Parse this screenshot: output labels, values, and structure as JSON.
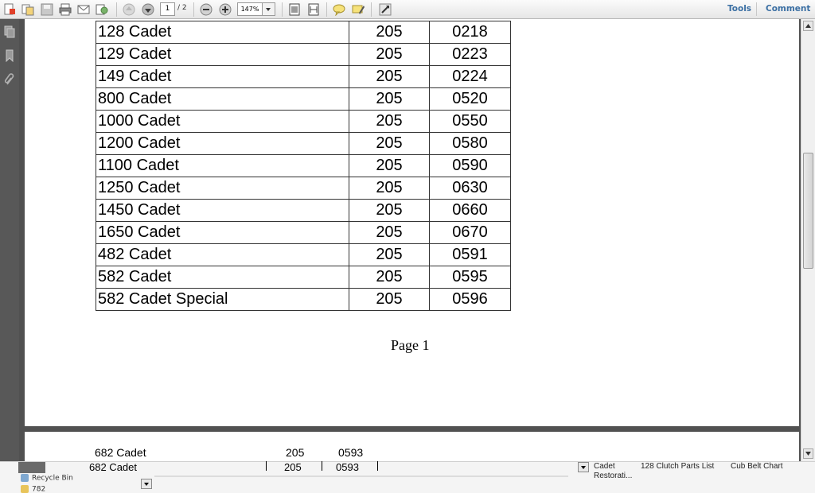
{
  "toolbar": {
    "page_current": "1",
    "page_total": "/ 2",
    "zoom": "147%",
    "tools_label": "Tools",
    "comment_label": "Comment",
    "icons": [
      "create-pdf-icon",
      "combine-icon",
      "save-icon",
      "print-icon",
      "email-icon",
      "review-icon",
      "previous-page-icon",
      "next-page-icon",
      "zoom-out-icon",
      "zoom-in-icon",
      "fit-page-icon",
      "fit-width-icon",
      "sticky-note-icon",
      "highlight-icon",
      "full-screen-icon"
    ]
  },
  "nav_pane": {
    "icons": [
      "pages-icon",
      "bookmarks-icon",
      "attachments-icon"
    ]
  },
  "document": {
    "rows": [
      {
        "model": "128 Cadet",
        "col2": "205",
        "col3": "0218"
      },
      {
        "model": "129 Cadet",
        "col2": "205",
        "col3": "0223"
      },
      {
        "model": "149 Cadet",
        "col2": "205",
        "col3": "0224"
      },
      {
        "model": "800 Cadet",
        "col2": "205",
        "col3": "0520"
      },
      {
        "model": "1000 Cadet",
        "col2": "205",
        "col3": "0550"
      },
      {
        "model": "1200 Cadet",
        "col2": "205",
        "col3": "0580"
      },
      {
        "model": "1100 Cadet",
        "col2": "205",
        "col3": "0590"
      },
      {
        "model": "1250 Cadet",
        "col2": "205",
        "col3": "0630"
      },
      {
        "model": "1450 Cadet",
        "col2": "205",
        "col3": "0660"
      },
      {
        "model": "1650 Cadet",
        "col2": "205",
        "col3": "0670"
      },
      {
        "model": "482 Cadet",
        "col2": "205",
        "col3": "0591"
      },
      {
        "model": "582 Cadet",
        "col2": "205",
        "col3": "0595"
      },
      {
        "model": "582 Cadet Special",
        "col2": "205",
        "col3": "0596"
      }
    ],
    "page_label": "Page 1",
    "page2_row": {
      "model": "682 Cadet",
      "col2": "205",
      "col3": "0593"
    }
  },
  "bottom": {
    "desktop_items": [
      "Recycle Bin",
      "782"
    ],
    "tab_links": [
      "Cadet Restorati...",
      "128 Clutch Parts List",
      "Cub Belt Chart"
    ]
  },
  "colors": {
    "viewport_bg": "#515151",
    "nav_pane_bg": "#585858",
    "toolbar_link": "#3b6fa3"
  }
}
